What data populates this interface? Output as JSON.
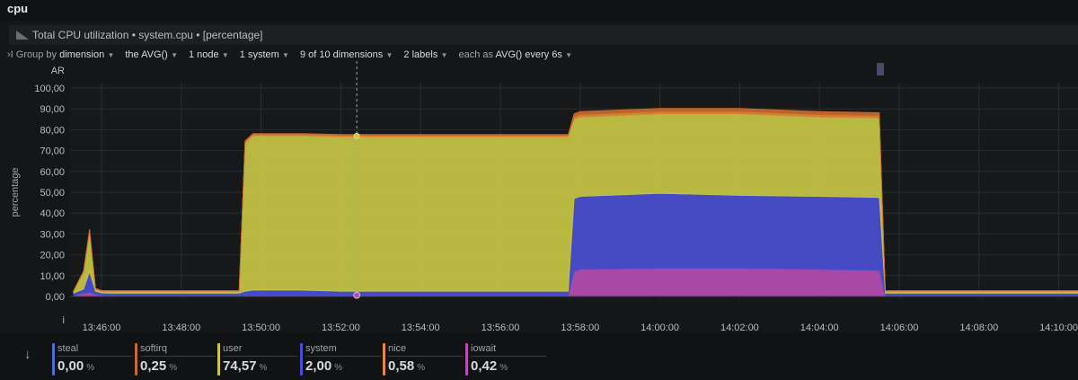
{
  "section": {
    "title": "cpu"
  },
  "header": {
    "text": "Total CPU utilization • system.cpu • [percentage]"
  },
  "controls": [
    {
      "label": "›I Group by",
      "value": "dimension",
      "caret": true
    },
    {
      "label": "",
      "value": "the AVG()",
      "caret": true
    },
    {
      "label": "",
      "value": "1 node",
      "caret": true
    },
    {
      "label": "",
      "value": "1 system",
      "caret": true
    },
    {
      "label": "",
      "value": "9 of 10 dimensions",
      "caret": true
    },
    {
      "label": "",
      "value": "2 labels",
      "caret": true
    },
    {
      "label": "each as",
      "value": "AVG() every 6s",
      "caret": true
    }
  ],
  "colors": {
    "iowait": "#b54fb1",
    "system": "#4b4fd2",
    "user": "#c8c845",
    "nice": "#e08a3a",
    "softirq": "#c96a2a",
    "steal": "#4a6fd0"
  },
  "chart_data": {
    "type": "area",
    "stacked": true,
    "ylabel": "percentage",
    "ylim": [
      0,
      100
    ],
    "ytick_labels": [
      "100,00",
      "90,00",
      "80,00",
      "70,00",
      "60,00",
      "50,00",
      "40,00",
      "30,00",
      "20,00",
      "10,00",
      "0,00"
    ],
    "ytick_values": [
      100,
      90,
      80,
      70,
      60,
      50,
      40,
      30,
      20,
      10,
      0
    ],
    "y_extra_labels": {
      "top": "AR",
      "bottom": "i"
    },
    "xtick_labels": [
      "13:46:00",
      "13:48:00",
      "13:50:00",
      "13:52:00",
      "13:54:00",
      "13:56:00",
      "13:58:00",
      "14:00:00",
      "14:02:00",
      "14:04:00",
      "14:06:00",
      "14:08:00",
      "14:10:00"
    ],
    "xtick_minutes": [
      0,
      2,
      4,
      6,
      8,
      10,
      12,
      14,
      16,
      18,
      20,
      22,
      24
    ],
    "x_minutes": [
      -0.7,
      -0.45,
      -0.3,
      -0.15,
      0,
      0.3,
      0.6,
      1.5,
      3,
      3.45,
      3.6,
      3.8,
      5,
      6,
      7,
      8,
      10,
      11.7,
      11.85,
      12,
      14,
      16,
      18,
      19.5,
      19.65,
      19.85,
      21,
      23,
      25
    ],
    "series": [
      {
        "name": "iowait",
        "values": [
          0.4,
          1.5,
          2,
          1,
          0.5,
          0.4,
          0.4,
          0.4,
          0.4,
          0.4,
          0.5,
          0.5,
          0.5,
          0.5,
          0.5,
          0.5,
          0.5,
          0.5,
          12,
          13,
          13.5,
          13.5,
          13,
          12.5,
          0.4,
          0.4,
          0.4,
          0.4,
          0.4
        ]
      },
      {
        "name": "system",
        "values": [
          1.2,
          2,
          10,
          1.5,
          1.2,
          1.2,
          1.2,
          1.2,
          1.2,
          1.2,
          2,
          2.5,
          2.5,
          2,
          2,
          2,
          2,
          2,
          35,
          35,
          36,
          35,
          35,
          35,
          1.2,
          1.2,
          1.2,
          1.2,
          1.2
        ]
      },
      {
        "name": "user",
        "values": [
          0.8,
          8,
          19,
          1,
          0.8,
          0.8,
          0.8,
          0.8,
          0.8,
          0.8,
          71,
          74,
          74,
          74,
          74,
          74,
          74,
          74,
          38,
          38,
          38,
          39,
          38,
          38,
          0.8,
          0.8,
          0.8,
          0.8,
          0.8
        ]
      },
      {
        "name": "nice",
        "values": [
          0.3,
          0.5,
          1,
          0.3,
          0.3,
          0.3,
          0.3,
          0.3,
          0.3,
          0.3,
          0.8,
          0.8,
          0.8,
          0.8,
          0.8,
          0.8,
          0.8,
          0.8,
          1.2,
          1.2,
          1.2,
          1.2,
          1.2,
          1.2,
          0.3,
          0.3,
          0.3,
          0.3,
          0.3
        ]
      },
      {
        "name": "softirq",
        "values": [
          0.1,
          0.2,
          0.3,
          0.1,
          0.1,
          0.1,
          0.1,
          0.1,
          0.1,
          0.1,
          0.4,
          0.4,
          0.4,
          0.4,
          0.4,
          0.4,
          0.4,
          0.4,
          1.5,
          1.5,
          1.5,
          1.5,
          1.5,
          1.5,
          0.1,
          0.1,
          0.1,
          0.1,
          0.1
        ]
      }
    ],
    "grid": true,
    "cursor_minute": 6.4
  },
  "legend": [
    {
      "name": "steal",
      "value": "0,00",
      "unit": "%",
      "color": "#4a6fd0"
    },
    {
      "name": "softirq",
      "value": "0,25",
      "unit": "%",
      "color": "#c96a2a"
    },
    {
      "name": "user",
      "value": "74,57",
      "unit": "%",
      "color": "#c8c845"
    },
    {
      "name": "system",
      "value": "2,00",
      "unit": "%",
      "color": "#4b4fd2"
    },
    {
      "name": "nice",
      "value": "0,58",
      "unit": "%",
      "color": "#e08a3a"
    },
    {
      "name": "iowait",
      "value": "0,42",
      "unit": "%",
      "color": "#b54fb1"
    }
  ],
  "legend_toggle": {
    "icon": "down-arrow-icon",
    "glyph": "↓"
  }
}
